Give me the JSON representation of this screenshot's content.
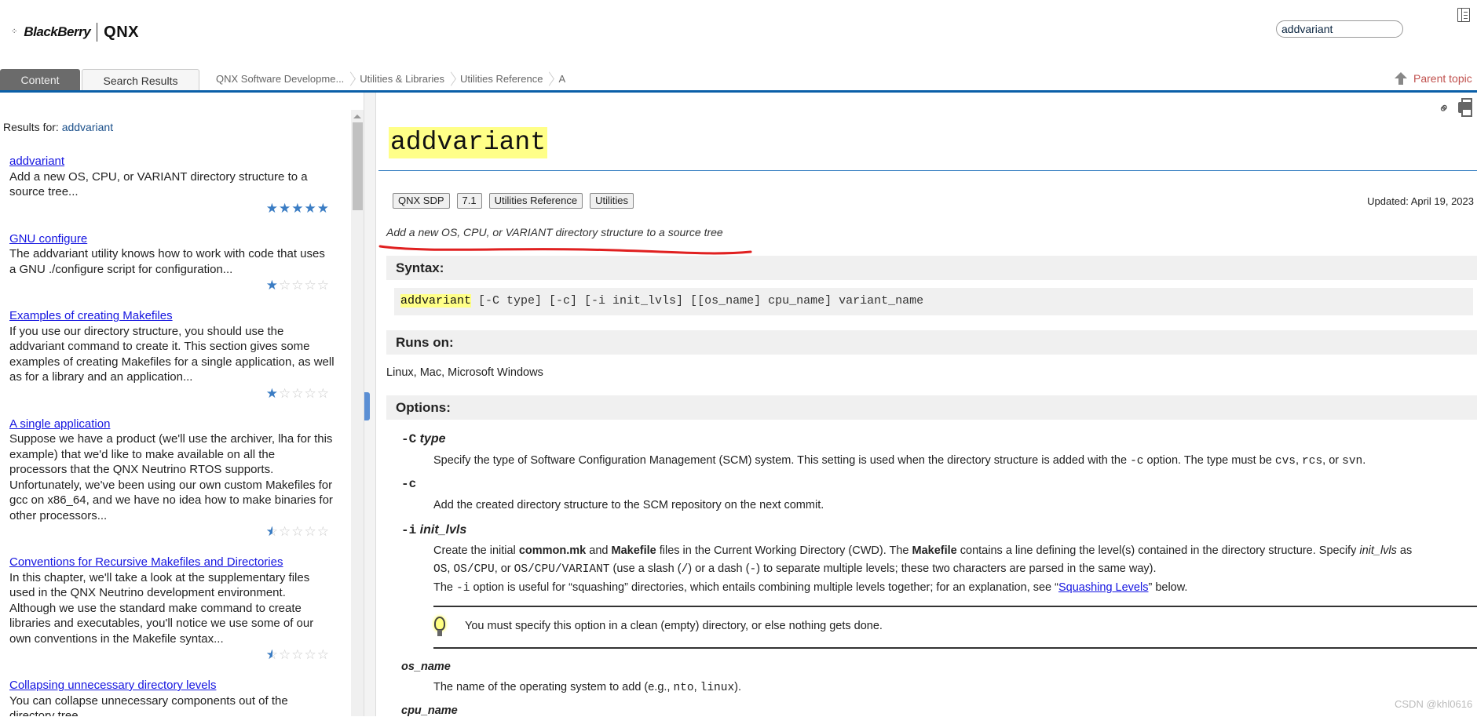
{
  "header": {
    "logo_brand": "BlackBerry",
    "logo_product": "QNX",
    "search_value": "addvariant",
    "parent_topic": "Parent topic"
  },
  "tabs": [
    {
      "label": "Content"
    },
    {
      "label": "Search Results"
    }
  ],
  "breadcrumb": [
    "QNX Software Developme...",
    "Utilities & Libraries",
    "Utilities Reference",
    "A"
  ],
  "sidebar": {
    "results_label": "Results for:",
    "query": "addvariant",
    "items": [
      {
        "title": "addvariant",
        "snippet": "Add a new OS, CPU, or VARIANT directory structure to a source tree...",
        "rating": 5
      },
      {
        "title": "GNU configure",
        "snippet": "The addvariant utility knows how to work with code that uses a GNU ./configure script for configuration...",
        "rating": 1
      },
      {
        "title": "Examples of creating Makefiles",
        "snippet": "If you use our directory structure, you should use the addvariant command to create it. This section gives some examples of creating Makefiles for a single application, as well as for a library and an application...",
        "rating": 1
      },
      {
        "title": "A single application",
        "snippet": "Suppose we have a product (we'll use the archiver, lha for this example) that we'd like to make available on all the processors that the QNX Neutrino RTOS supports. Unfortunately, we've been using our own custom Makefiles for gcc on x86_64, and we have no idea how to make binaries for other processors...",
        "rating": 0.5
      },
      {
        "title": "Conventions for Recursive Makefiles and Directories",
        "snippet": "In this chapter, we'll take a look at the supplementary files used in the QNX Neutrino development environment. Although we use the standard make command to create libraries and executables, you'll notice we use some of our own conventions in the Makefile syntax...",
        "rating": 0.5
      },
      {
        "title": "Collapsing unnecessary directory levels",
        "snippet": "You can collapse unnecessary components out of the directory tree...",
        "rating": null
      }
    ]
  },
  "main": {
    "title": "addvariant",
    "badges": [
      "QNX SDP",
      "7.1",
      "Utilities Reference",
      "Utilities"
    ],
    "updated": "Updated: April 19, 2023",
    "description": "Add a new OS, CPU, or VARIANT directory structure to a source tree",
    "syntax_heading": "Syntax:",
    "syntax": {
      "cmd": "addvariant",
      "rest": " [-C type] [-c] [-i init_lvls] [[os_name] cpu_name] variant_name"
    },
    "runs_on_heading": "Runs on:",
    "runs_on": "Linux, Mac, Microsoft Windows",
    "options_heading": "Options:",
    "opt_C": {
      "flag": "-C",
      "arg": "type",
      "desc": "Specify the type of Software Configuration Management (SCM) system. This setting is used when the directory structure is added with the ",
      "desc_code": "-c",
      "desc2": " option. The type must be ",
      "v1": "cvs",
      "v2": "rcs",
      "v3": "svn",
      "sep1": ", ",
      "sep2": ", or ",
      "end": "."
    },
    "opt_c": {
      "flag": "-c",
      "desc": "Add the created directory structure to the SCM repository on the next commit."
    },
    "opt_i": {
      "flag": "-i",
      "arg": "init_lvls",
      "p1a": "Create the initial ",
      "b1": "common.mk",
      "p1b": " and ",
      "b2": "Makefile",
      "p1c": " files in the Current Working Directory (CWD). The ",
      "b3": "Makefile",
      "p1d": " contains a line defining the level(s) contained in the directory structure. Specify ",
      "i1": "init_lvls",
      "p1e": " as",
      "l2a": "OS",
      "l2s1": ", ",
      "l2b": "OS/CPU",
      "l2s2": ", or ",
      "l2c": "OS/CPU/VARIANT",
      "l2d": " (use a slash (",
      "slash": "/",
      "l2e": ") or a dash (",
      "dash": "-",
      "l2f": ") to separate multiple levels; these two characters are parsed in the same way).",
      "p3a": "The ",
      "p3code": "-i",
      "p3b": " option is useful for “squashing” directories, which entails combining multiple levels together; for an explanation, see “",
      "p3link": "Squashing Levels",
      "p3c": "” below."
    },
    "note": "You must specify this option in a clean (empty) directory, or else nothing gets done.",
    "os_name": {
      "label": "os_name",
      "desc_a": "The name of the operating system to add (e.g., ",
      "c1": "nto",
      "sep": ", ",
      "c2": "linux",
      "desc_b": ")."
    },
    "cpu_name": {
      "label": "cpu_name"
    }
  },
  "watermark": "CSDN @khl0616",
  "colors": {
    "accent_blue": "#0a5fa8",
    "highlight": "#ffff88",
    "star": "#3b7dc4",
    "parent_topic": "#c0504d",
    "annotation": "#e02020"
  }
}
